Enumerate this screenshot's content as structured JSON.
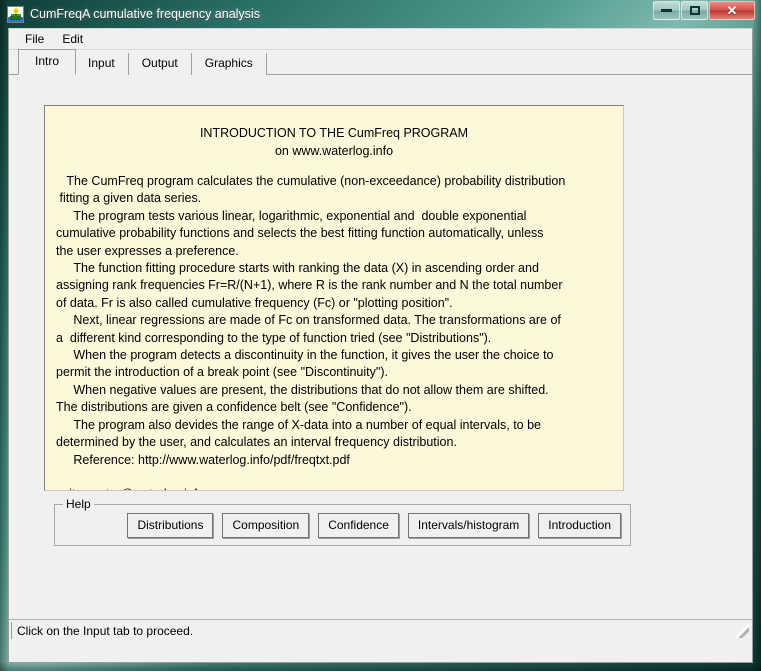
{
  "window": {
    "title": "CumFreqA cumulative frequency analysis",
    "icon": "plant-flower-icon",
    "caption": {
      "minimize_label": "Minimize",
      "maximize_label": "Maximize",
      "close_label": "✕"
    }
  },
  "menubar": {
    "items": [
      {
        "label": "File"
      },
      {
        "label": "Edit"
      }
    ]
  },
  "tabs": [
    {
      "label": "Intro",
      "active": true
    },
    {
      "label": "Input",
      "active": false
    },
    {
      "label": "Output",
      "active": false
    },
    {
      "label": "Graphics",
      "active": false
    }
  ],
  "intro": {
    "heading_line1": "INTRODUCTION TO THE CumFreq PROGRAM",
    "heading_line2": "on www.waterlog.info",
    "body": "   The CumFreq program calculates the cumulative (non-exceedance) probability distribution\n fitting a given data series.\n     The program tests various linear, logarithmic, exponential and  double exponential\ncumulative probability functions and selects the best fitting function automatically, unless\nthe user expresses a preference.\n     The function fitting procedure starts with ranking the data (X) in ascending order and\nassigning rank frequencies Fr=R/(N+1), where R is the rank number and N the total number\nof data. Fr is also called cumulative frequency (Fc) or \"plotting position\".\n     Next, linear regressions are made of Fc on transformed data. The transformations are of\na  different kind corresponding to the type of function tried (see \"Distributions\").\n     When the program detects a discontinuity in the function, it gives the user the choice to\npermit the introduction of a break point (see \"Discontinuity\").\n     When negative values are present, the distributions that do not allow them are shifted.\nThe distributions are given a confidence belt (see \"Confidence\").\n     The program also devides the range of X-data into a number of equal intervals, to be\ndetermined by the user, and calculates an interval frequency distribution.\n     Reference: http://www.waterlog.info/pdf/freqtxt.pdf\n\n  sitemaster@waterlog.info"
  },
  "help": {
    "legend": "Help",
    "buttons": [
      {
        "label": "Distributions"
      },
      {
        "label": "Composition"
      },
      {
        "label": "Confidence"
      },
      {
        "label": "Intervals/histogram"
      },
      {
        "label": "Introduction"
      }
    ]
  },
  "status": {
    "message": "Click on the Input tab to proceed."
  },
  "colors": {
    "titlebar_teal": "#2b6f64",
    "panel_cream": "#fdf8da",
    "chrome_gray": "#f0f0f0",
    "close_red": "#c2463c"
  }
}
